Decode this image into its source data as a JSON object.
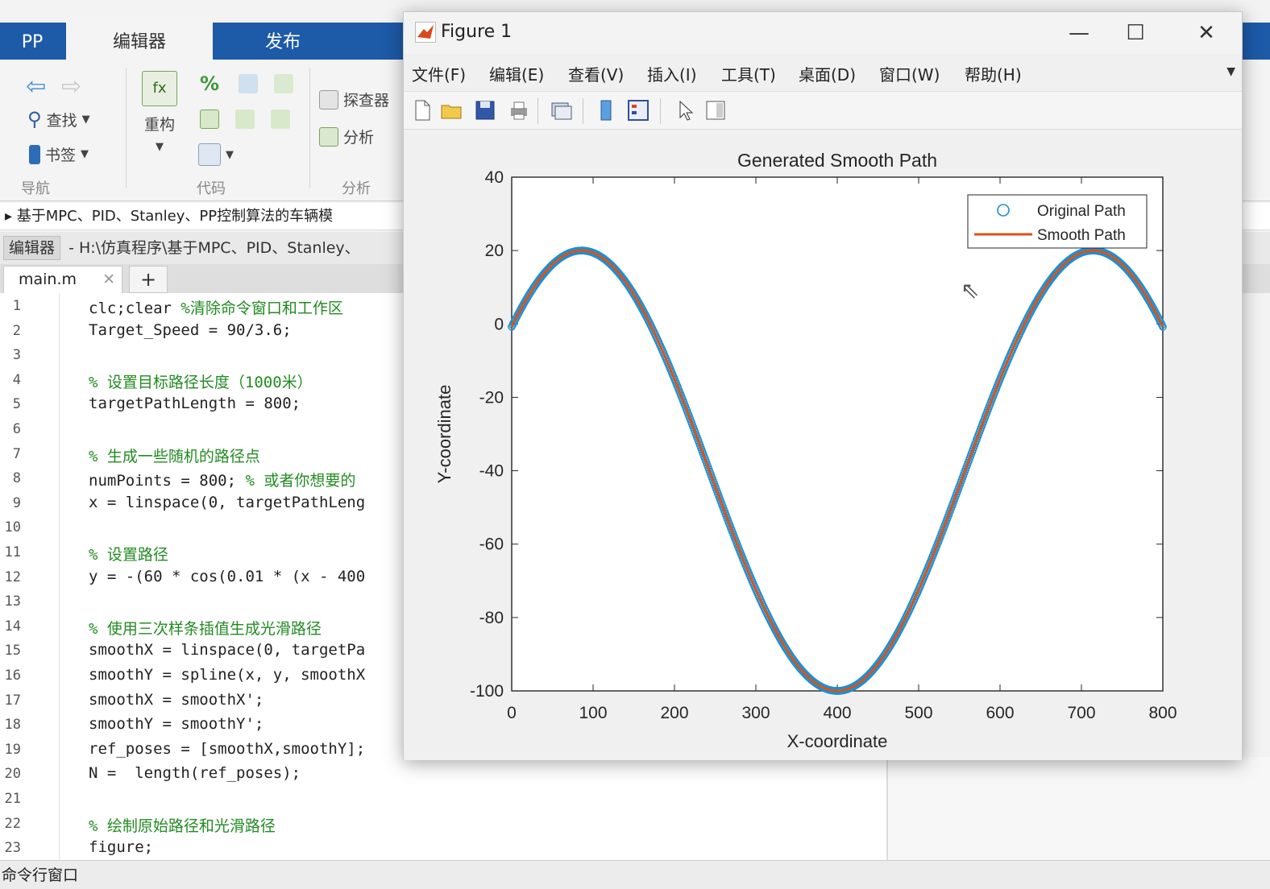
{
  "matlab": {
    "tabs": [
      "PP",
      "编辑器",
      "发布"
    ],
    "toolstrip": {
      "nav": {
        "find_label": "查找",
        "bookmark_label": "书签",
        "group_label": "导航"
      },
      "code": {
        "refactor_label": "重构",
        "group_label": "代码"
      },
      "analyze": {
        "explorer_label": "探查器",
        "analyze_label": "分析",
        "group_label": "分析"
      }
    },
    "path_bar": "基于MPC、PID、Stanley、PP控制算法的车辆模",
    "editor_title": {
      "tag": "编辑器",
      "path": "- H:\\仿真程序\\基于MPC、PID、Stanley、"
    },
    "file_tab": "main.m",
    "new_tab": "+",
    "code_lines": [
      {
        "n": "1",
        "text": "clc;clear ",
        "comment": "%清除命令窗口和工作区"
      },
      {
        "n": "2",
        "text": "Target_Speed = 90/3.6;",
        "comment": ""
      },
      {
        "n": "3",
        "text": "",
        "comment": ""
      },
      {
        "n": "4",
        "text": "",
        "comment": "% 设置目标路径长度（1000米）"
      },
      {
        "n": "5",
        "text": "targetPathLength = 800;",
        "comment": ""
      },
      {
        "n": "6",
        "text": "",
        "comment": ""
      },
      {
        "n": "7",
        "text": "",
        "comment": "% 生成一些随机的路径点"
      },
      {
        "n": "8",
        "text": "numPoints = 800; ",
        "comment": "% 或者你想要的"
      },
      {
        "n": "9",
        "text": "x = linspace(0, targetPathLeng",
        "comment": ""
      },
      {
        "n": "10",
        "text": "",
        "comment": ""
      },
      {
        "n": "11",
        "text": "",
        "comment": "% 设置路径"
      },
      {
        "n": "12",
        "text": "y = -(60 * cos(0.01 * (x - 400",
        "comment": ""
      },
      {
        "n": "13",
        "text": "",
        "comment": ""
      },
      {
        "n": "14",
        "text": "",
        "comment": "% 使用三次样条插值生成光滑路径"
      },
      {
        "n": "15",
        "text": "smoothX = linspace(0, targetPa",
        "comment": ""
      },
      {
        "n": "16",
        "text": "smoothY = spline(x, y, smoothX",
        "comment": ""
      },
      {
        "n": "17",
        "text": "smoothX = smoothX';",
        "comment": ""
      },
      {
        "n": "18",
        "text": "smoothY = smoothY';",
        "comment": ""
      },
      {
        "n": "19",
        "text": "ref_poses = [smoothX,smoothY];",
        "comment": ""
      },
      {
        "n": "20",
        "text": "N =  length(ref_poses);",
        "comment": ""
      },
      {
        "n": "21",
        "text": "",
        "comment": ""
      },
      {
        "n": "22",
        "text": "",
        "comment": "% 绘制原始路径和光滑路径"
      },
      {
        "n": "23",
        "text": "figure;",
        "comment": ""
      }
    ],
    "command_window_label": "命令行窗口"
  },
  "figure": {
    "title": "Figure 1",
    "window_buttons": {
      "minimize": "—",
      "maximize": "☐",
      "close": "✕"
    },
    "menu": [
      "文件(F)",
      "编辑(E)",
      "查看(V)",
      "插入(I)",
      "工具(T)",
      "桌面(D)",
      "窗口(W)",
      "帮助(H)"
    ],
    "toolbar_icons": [
      "new-file-icon",
      "open-folder-icon",
      "save-icon",
      "print-icon",
      "link-plot-icon",
      "colorbar-icon",
      "legend-icon",
      "pointer-icon",
      "property-editor-icon"
    ]
  },
  "chart_data": {
    "type": "line",
    "title": "Generated Smooth Path",
    "xlabel": "X-coordinate",
    "ylabel": "Y-coordinate",
    "xlim": [
      0,
      800
    ],
    "ylim": [
      -100,
      40
    ],
    "xticks": [
      0,
      100,
      200,
      300,
      400,
      500,
      600,
      700,
      800
    ],
    "yticks": [
      40,
      20,
      0,
      -20,
      -40,
      -60,
      -80,
      -100
    ],
    "legend_position": "top-right",
    "series": [
      {
        "name": "Original Path",
        "style": "circle-markers",
        "color": "#1f8fd0",
        "formula": "y = -(60*cos(0.01*(x-400)) + 40)",
        "n_points": 800
      },
      {
        "name": "Smooth Path",
        "style": "line",
        "color": "#d95319"
      }
    ],
    "sample_points": [
      [
        0,
        0
      ],
      [
        100,
        20
      ],
      [
        200,
        -20
      ],
      [
        300,
        -72.4
      ],
      [
        400,
        -100
      ],
      [
        500,
        -72.4
      ],
      [
        600,
        -20
      ],
      [
        700,
        20
      ],
      [
        800,
        0
      ]
    ]
  }
}
